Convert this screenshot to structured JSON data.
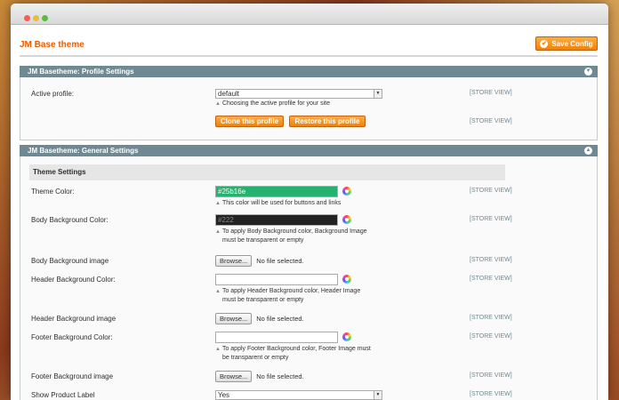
{
  "header": {
    "title": "JM Base theme",
    "save_label": "Save Config"
  },
  "profile_section": {
    "title": "JM Basetheme: Profile Settings",
    "active_profile_label": "Active profile:",
    "active_profile_value": "default",
    "active_profile_note": "Choosing the active profile for your site",
    "scope_1": "[STORE VIEW]",
    "scope_2": "[STORE VIEW]",
    "clone_label": "Clone this profile",
    "restore_label": "Restore this profile"
  },
  "general_section": {
    "title": "JM Basetheme: General Settings",
    "subheading": "Theme Settings",
    "theme_color": {
      "label": "Theme Color:",
      "value": "#25b16e",
      "swatch_color": "#25b16e",
      "note": "This color will be used for buttons and links",
      "scope": "[STORE VIEW]"
    },
    "body_bg_color": {
      "label": "Body Background Color:",
      "value": "#222",
      "swatch_color": "#222222",
      "note_line1": "To apply Body Background color, Background Image",
      "note_line2": "must be transparent or empty",
      "scope": "[STORE VIEW]"
    },
    "body_bg_image": {
      "label": "Body Background image",
      "browse": "Browse...",
      "file": "No file selected.",
      "scope": "[STORE VIEW]"
    },
    "header_bg_color": {
      "label": "Header Background Color:",
      "value": "",
      "note_line1": "To apply Header Background color, Header Image",
      "note_line2": "must be transparent or empty",
      "scope": "[STORE VIEW]"
    },
    "header_bg_image": {
      "label": "Header Background image",
      "browse": "Browse...",
      "file": "No file selected.",
      "scope": "[STORE VIEW]"
    },
    "footer_bg_color": {
      "label": "Footer Background Color:",
      "value": "",
      "note_line1": "To apply Footer Background color, Footer Image must",
      "note_line2": "be transparent or empty",
      "scope": "[STORE VIEW]"
    },
    "footer_bg_image": {
      "label": "Footer Background image",
      "browse": "Browse...",
      "file": "No file selected.",
      "scope": "[STORE VIEW]"
    },
    "product_label": {
      "label": "Show Product Label",
      "value": "Yes",
      "scope": "[STORE VIEW]"
    }
  },
  "colors": {
    "accent": "#eb5e00",
    "section_header": "#6f8992"
  }
}
